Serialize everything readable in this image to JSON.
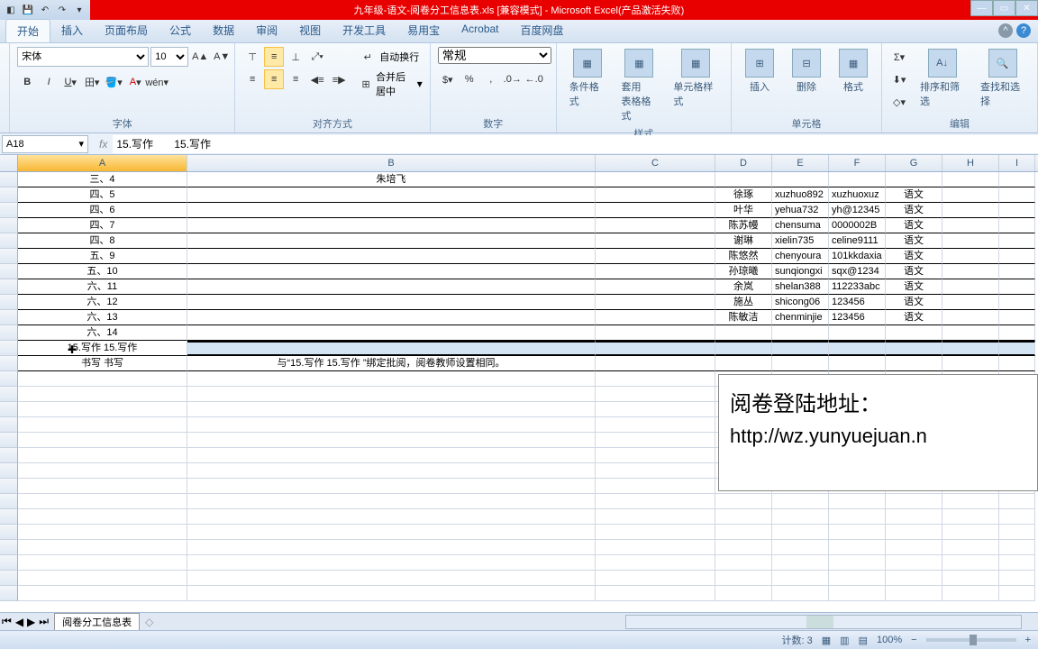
{
  "title": "九年级-语文-阅卷分工信息表.xls [兼容模式] - Microsoft Excel(产品激活失败)",
  "tabs": [
    "开始",
    "插入",
    "页面布局",
    "公式",
    "数据",
    "审阅",
    "视图",
    "开发工具",
    "易用宝",
    "Acrobat",
    "百度网盘"
  ],
  "font": {
    "name": "宋体",
    "size": "10"
  },
  "groups": {
    "font": "字体",
    "align": "对齐方式",
    "number": "数字",
    "style": "样式",
    "cell": "单元格",
    "edit": "编辑"
  },
  "numfmt": "常规",
  "alignbtns": {
    "wrap": "自动换行",
    "merge": "合并后居中"
  },
  "stylebtns": {
    "cond": "条件格式",
    "tbl": "套用\n表格格式",
    "cell": "单元格样式"
  },
  "cellbtns": {
    "ins": "插入",
    "del": "删除",
    "fmt": "格式"
  },
  "editbtns": {
    "sort": "排序和筛选",
    "find": "查找和选择"
  },
  "namebox": "A18",
  "formula": "15.写作       15.写作",
  "cols": [
    "A",
    "B",
    "C",
    "D",
    "E",
    "F",
    "G",
    "H",
    "I"
  ],
  "data": [
    {
      "A": "三、4",
      "B": "朱培飞"
    },
    {
      "A": "四、5",
      "D": "徐琢",
      "E": "xuzhuo892",
      "F": "xuzhuoxuz",
      "G": "语文"
    },
    {
      "A": "四、6",
      "D": "叶华",
      "E": "yehua732",
      "F": "yh@12345",
      "G": "语文"
    },
    {
      "A": "四、7",
      "D": "陈苏幔",
      "E": "chensuma",
      "F": "0000002B",
      "G": "语文"
    },
    {
      "A": "四、8",
      "D": "谢琳",
      "E": "xielin735",
      "F": "celine9111",
      "G": "语文"
    },
    {
      "A": "五、9",
      "D": "陈悠然",
      "E": "chenyoura",
      "F": "101kkdaxia",
      "G": "语文"
    },
    {
      "A": "五、10",
      "D": "孙琼曦",
      "E": "sunqiongxi",
      "F": "sqx@1234",
      "G": "语文"
    },
    {
      "A": "六、11",
      "D": "余岚",
      "E": "shelan388",
      "F": "112233abc",
      "G": "语文"
    },
    {
      "A": "六、12",
      "D": "施丛",
      "E": "shicong06",
      "F": "123456",
      "G": "语文"
    },
    {
      "A": "六、13",
      "D": "陈敏洁",
      "E": "chenminjie",
      "F": "123456",
      "G": "语文"
    },
    {
      "A": "六、14"
    },
    {
      "A": "15.写作   15.写作",
      "sel": true
    },
    {
      "A": "书写 书写",
      "B": "与“15.写作       15.写作     ”绑定批阅，阅卷教师设置相同。"
    }
  ],
  "textbox": {
    "l1": "阅卷登陆地址：",
    "l2": "http://wz.yunyuejuan.n"
  },
  "sheettab": "阅卷分工信息表",
  "status": {
    "count": "计数: 3",
    "zoom": "100%"
  }
}
